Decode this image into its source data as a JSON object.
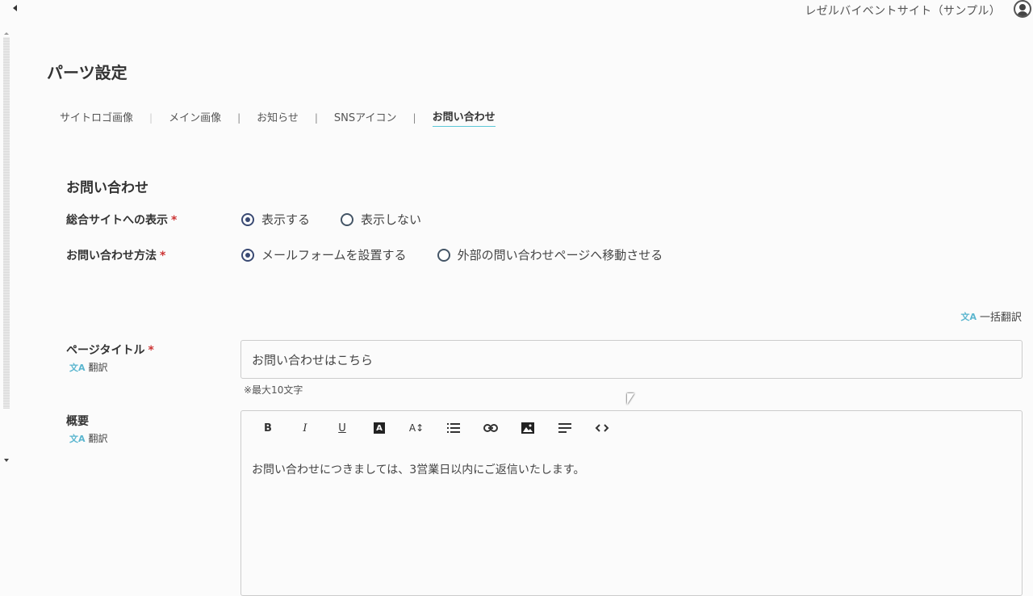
{
  "header": {
    "site_name": "レゼルバイベントサイト（サンプル）"
  },
  "page": {
    "title": "パーツ設定"
  },
  "tabs": [
    {
      "label": "サイトロゴ画像",
      "active": false
    },
    {
      "label": "メイン画像",
      "active": false
    },
    {
      "label": "お知らせ",
      "active": false
    },
    {
      "label": "SNSアイコン",
      "active": false
    },
    {
      "label": "お問い合わせ",
      "active": true
    }
  ],
  "tab_separator": "|",
  "section": {
    "title": "お問い合わせ",
    "required_mark": "*",
    "display": {
      "label": "総合サイトへの表示",
      "options": [
        {
          "label": "表示する",
          "checked": true
        },
        {
          "label": "表示しない",
          "checked": false
        }
      ]
    },
    "method": {
      "label": "お問い合わせ方法",
      "options": [
        {
          "label": "メールフォームを設置する",
          "checked": true
        },
        {
          "label": "外部の問い合わせページへ移動させる",
          "checked": false
        }
      ]
    },
    "bulk_translate": "一括翻訳",
    "translate_icon": "文A",
    "page_title_field": {
      "label": "ページタイトル",
      "translate": "翻訳",
      "value": "お問い合わせはこちら",
      "hint": "※最大10文字"
    },
    "summary_field": {
      "label": "概要",
      "translate": "翻訳",
      "toolbar": {
        "bold": "B",
        "italic": "I",
        "underline": "U",
        "text_color": "A",
        "font_size": "A↕"
      },
      "content": "お問い合わせにつきましては、3営業日以内にご返信いたします。"
    }
  },
  "colors": {
    "accent": "#5bc7d8",
    "radio_checked": "#3a4a73",
    "required": "#cc3333"
  }
}
